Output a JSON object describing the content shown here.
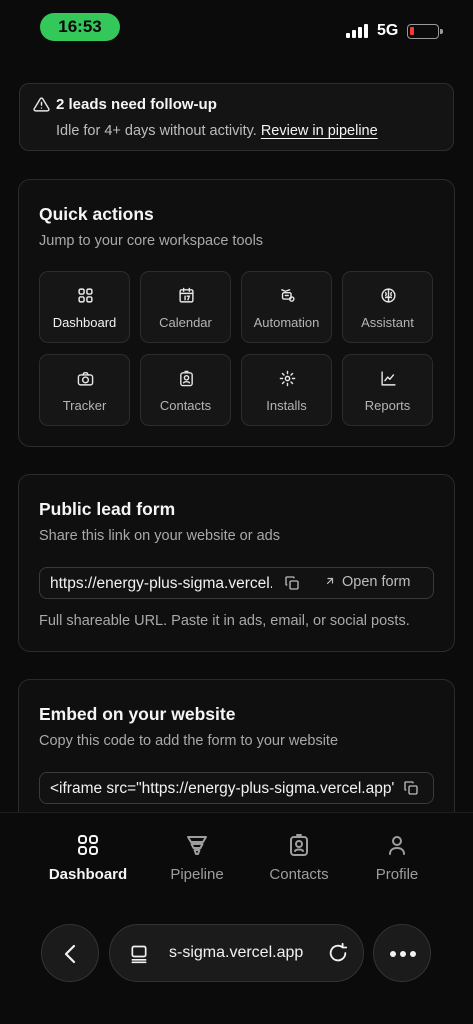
{
  "status_bar": {
    "time": "16:53",
    "network": "5G"
  },
  "alert": {
    "title": "2 leads need follow-up",
    "subtitle": "Idle for 4+ days without activity.",
    "link": "Review in pipeline",
    "icon": "warning-triangle-icon"
  },
  "quick_actions": {
    "title": "Quick actions",
    "subtitle": "Jump to your core workspace tools",
    "tiles": [
      {
        "label": "Dashboard",
        "icon": "grid-icon"
      },
      {
        "label": "Calendar",
        "icon": "calendar-icon"
      },
      {
        "label": "Automation",
        "icon": "automation-icon"
      },
      {
        "label": "Assistant",
        "icon": "brain-icon"
      },
      {
        "label": "Tracker",
        "icon": "camera-icon"
      },
      {
        "label": "Contacts",
        "icon": "contact-badge-icon"
      },
      {
        "label": "Installs",
        "icon": "gear-icon"
      },
      {
        "label": "Reports",
        "icon": "chart-icon"
      }
    ]
  },
  "lead_form": {
    "title": "Public lead form",
    "subtitle": "Share this link on your website or ads",
    "url": "https://energy-plus-sigma.vercel.app",
    "open_label": "Open form",
    "hint": "Full shareable URL. Paste it in ads, email, or social posts."
  },
  "embed": {
    "title": "Embed on your website",
    "subtitle": "Copy this code to add the form to your website",
    "code": "<iframe src=\"https://energy-plus-sigma.vercel.app\"></iframe>"
  },
  "tabbar": {
    "items": [
      {
        "label": "Dashboard",
        "icon": "grid-icon"
      },
      {
        "label": "Pipeline",
        "icon": "funnel-icon"
      },
      {
        "label": "Contacts",
        "icon": "contact-badge-icon"
      },
      {
        "label": "Profile",
        "icon": "person-icon"
      }
    ]
  },
  "browser": {
    "address": "s-sigma.vercel.app"
  }
}
